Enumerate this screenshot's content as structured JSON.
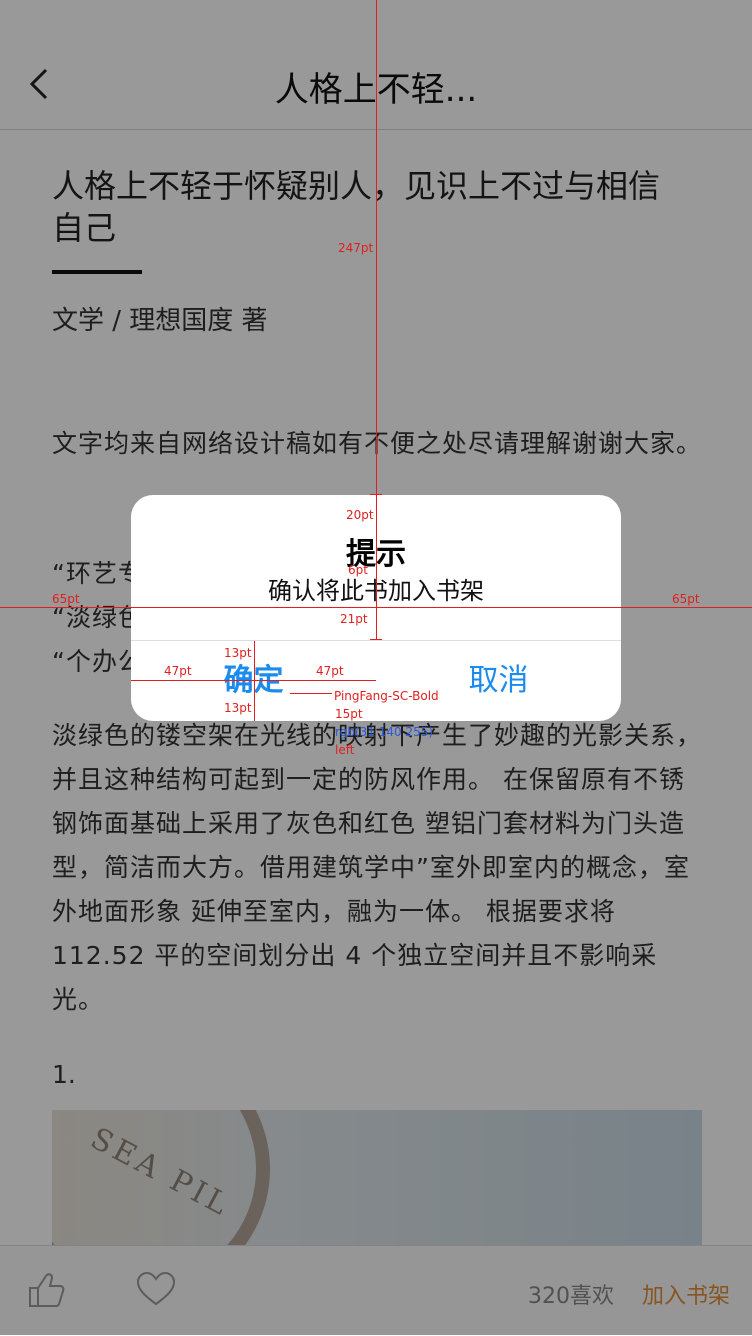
{
  "nav": {
    "title": "人格上不轻..."
  },
  "article": {
    "title": "人格上不轻于怀疑别人，见识上不过与相信自己",
    "byline": "文学 / 理想国度 著",
    "para1": "文字均来自网络设计稿如有不便之处尽请理解谢谢大家。",
    "quote1": "“环艺专",
    "quote2": "“淡绿色",
    "quote3": "“个办公",
    "para2": "淡绿色的镂空架在光线的映射下产生了妙趣的光影关系， 并且这种结构可起到一定的防风作用。 在保留原有不锈钢饰面基础上采用了灰色和红色 塑铝门套材料为门头造型，简洁而大方。借用建筑学中”室外即室内的概念，室外地面形象 延伸至室内，融为一体。 根据要求将 112.52 平的空间划分出 4 个独立空间并且不影响采光。",
    "section_num": "1.",
    "photo_text": "SEA PIL"
  },
  "toolbar": {
    "like_icon": "thumbs-up-icon",
    "fav_icon": "heart-icon",
    "like_count": "320喜欢",
    "add_to_shelf": "加入书架",
    "accent_color": "#e08e3a"
  },
  "dialog": {
    "title": "提示",
    "message": "确认将此书加入书架",
    "confirm_label": "确定",
    "cancel_label": "取消",
    "button_color": "#1a8cf0"
  },
  "annotations": {
    "a247": "247pt",
    "a20": "20pt",
    "a6": "6pt",
    "a21": "21pt",
    "a65_left": "65pt",
    "a65_right": "65pt",
    "a13_top": "13pt",
    "a13_bottom": "13pt",
    "a47_left": "47pt",
    "a47_right": "47pt",
    "font": "PingFang-SC-Bold",
    "a15": "15pt",
    "color_spec": "rgb(31 140 255)",
    "align": "left"
  }
}
